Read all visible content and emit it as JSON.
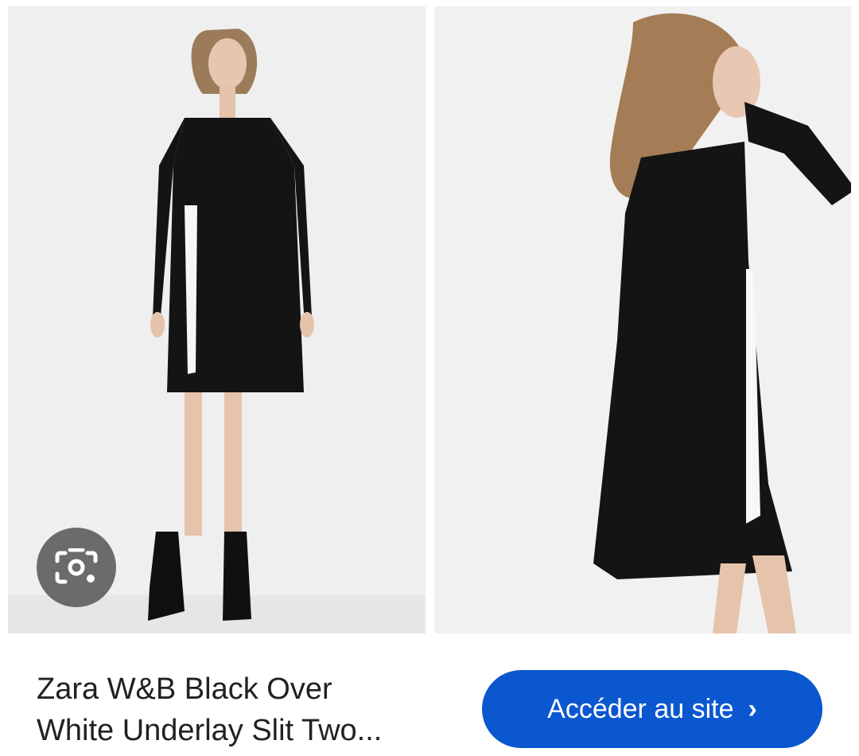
{
  "images": [
    {
      "alt": "Woman in black long-sleeve dress with white underlay slit, front view"
    },
    {
      "alt": "Woman in black long-sleeve dress with white underlay slit, side view"
    }
  ],
  "lens": {
    "icon": "lens-camera-icon"
  },
  "result": {
    "title_line1": "Zara W&B Black Over",
    "title_line2": "White Underlay Slit Two..."
  },
  "visit": {
    "label": "Accéder au site",
    "chevron": "›"
  },
  "colors": {
    "button": "#0b57d0",
    "text": "#202124",
    "photo_bg": "#eeeeee"
  }
}
